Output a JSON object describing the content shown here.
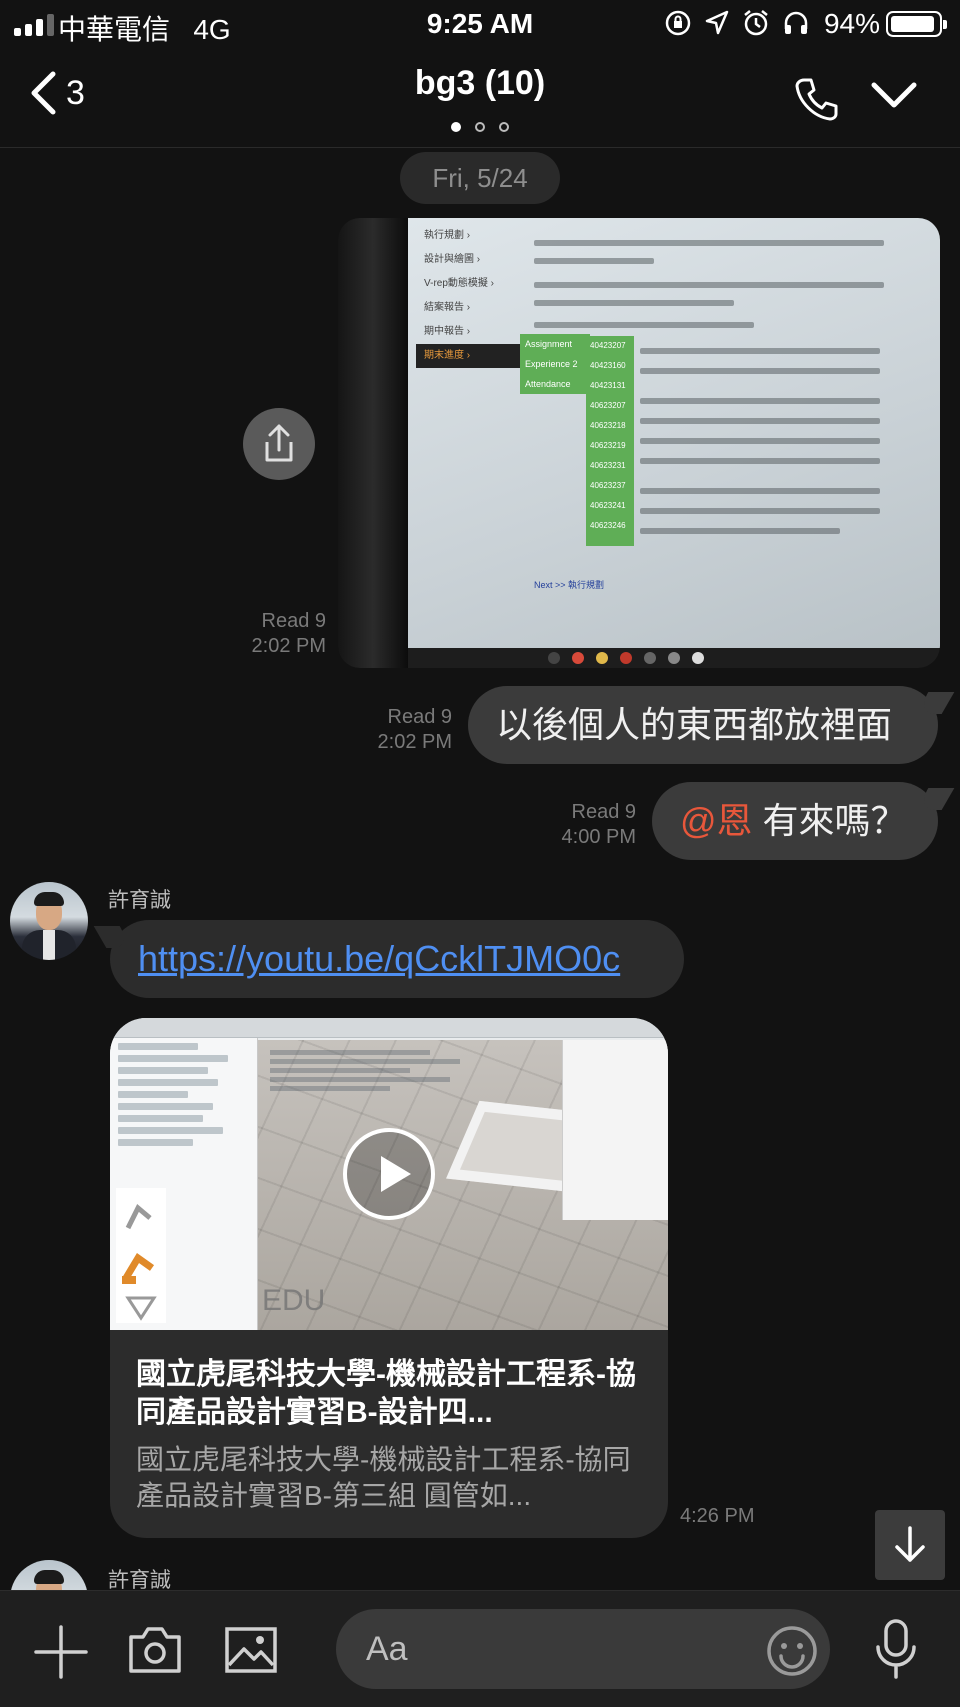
{
  "status_bar": {
    "carrier": "中華電信",
    "network": "4G",
    "time": "9:25 AM",
    "battery": "94%",
    "battery_level": 0.94,
    "icons": [
      "orientation-lock-icon",
      "location-icon",
      "alarm-icon",
      "headphones-icon"
    ]
  },
  "nav": {
    "back_count": "3",
    "title": "bg3 (10)",
    "page_dots": 3,
    "active_dot": 0,
    "icons": [
      "back-chevron-icon",
      "phone-icon",
      "chevron-down-icon"
    ]
  },
  "date_chip": "Fri, 5/24",
  "photo_message": {
    "read": "Read 9",
    "time": "2:02 PM",
    "screen": {
      "menu_items": [
        "執行規劃 ›",
        "設計與繪圖 ›",
        "V-rep動態模擬 ›",
        "結案報告 ›",
        "期中報告 ›",
        "期末進度 ›"
      ],
      "submenu": [
        "Assignment",
        "Experience 2",
        "Attendance"
      ],
      "id_list": [
        "40423207",
        "40423160",
        "40423131",
        "40623207",
        "40623218",
        "40623219",
        "40623231",
        "40623237",
        "40623241",
        "40623246"
      ],
      "link_text": "Next >> 執行規劃"
    }
  },
  "sent_messages": [
    {
      "read": "Read 9",
      "time": "2:02 PM",
      "text": "以後個人的東西都放裡面"
    },
    {
      "read": "Read 9",
      "time": "4:00 PM",
      "mention": "@恩",
      "text": " 有來嗎？"
    }
  ],
  "received": {
    "sender": "許育誠",
    "link": "https://youtu.be/qCcklTJMO0c",
    "video_card": {
      "watermark": "EDU",
      "title": "國立虎尾科技大學-機械設計工程系-協同產品設計實習B-設計四...",
      "description": "國立虎尾科技大學-機械設計工程系-協同產品設計實習B-第三組 圓管如...",
      "time": "4:26 PM"
    },
    "next_sender": "許育誠"
  },
  "input_bar": {
    "placeholder": "Aa",
    "icons": [
      "plus-icon",
      "camera-icon",
      "image-icon",
      "emoji-icon",
      "microphone-icon"
    ]
  },
  "colors": {
    "background": "#121212",
    "bubble_out": "#3b3b3b",
    "bubble_in": "#2c2c2c",
    "link": "#4f8ff2",
    "mention": "#e8573b"
  }
}
